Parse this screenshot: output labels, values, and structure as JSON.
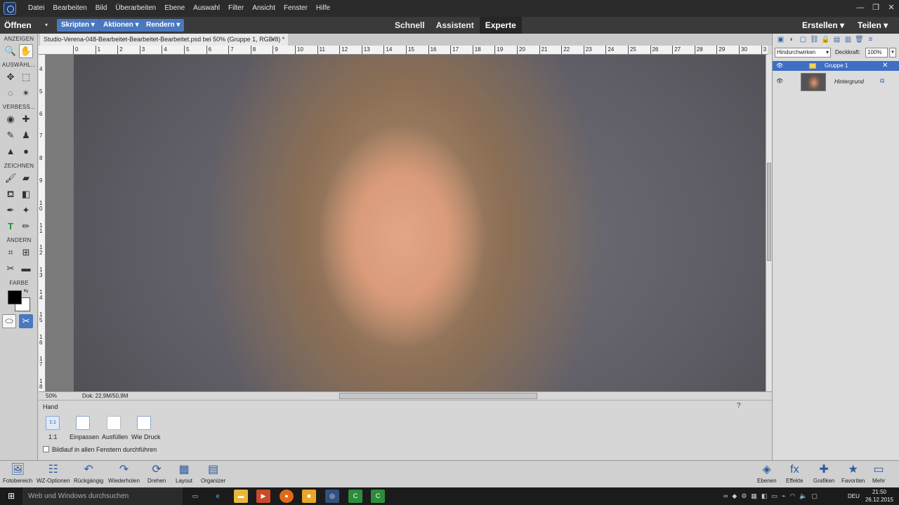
{
  "menu": [
    "Datei",
    "Bearbeiten",
    "Bild",
    "Überarbeiten",
    "Ebene",
    "Auswahl",
    "Filter",
    "Ansicht",
    "Fenster",
    "Hilfe"
  ],
  "window_controls": [
    "—",
    "❐",
    "✕"
  ],
  "modebar": {
    "open": "Öffnen",
    "open_arrow": "▾",
    "scripts": "Skripten",
    "actions": "Aktionen",
    "render": "Rendern",
    "tabs": [
      "Schnell",
      "Assistent",
      "Experte"
    ],
    "create": "Erstellen",
    "share": "Teilen"
  },
  "toolbox": {
    "sections": [
      "ANZEIGEN",
      "AUSWÄHL...",
      "VERBESS...",
      "ZEICHNEN",
      "ÄNDERN",
      "FARBE"
    ]
  },
  "document": {
    "tab_title": "Studio-Verena-048-Bearbeitet-Bearbeitet-Bearbeitet.psd bei 50% (Gruppe 1, RGB/8) *",
    "close": "×",
    "zoom": "50%",
    "doc_size": "Dok: 22,9M/50,9M",
    "ruler_h": [
      "0",
      "1",
      "2",
      "3",
      "4",
      "5",
      "6",
      "7",
      "8",
      "9",
      "10",
      "11",
      "12",
      "13",
      "14",
      "15",
      "16",
      "17",
      "18",
      "19",
      "20",
      "21",
      "22",
      "23",
      "24",
      "25",
      "26",
      "27",
      "28",
      "29",
      "30",
      "3"
    ],
    "ruler_v": [
      "4",
      "5",
      "6",
      "7",
      "8",
      "9",
      "1 0",
      "1 1",
      "1 2",
      "1 3",
      "1 4",
      "1 5",
      "1 6",
      "1 7",
      "1 8"
    ]
  },
  "tool_options": {
    "tool_name": "Hand",
    "buttons": [
      {
        "label": "1:1",
        "glyph": "1:1"
      },
      {
        "label": "Einpassen",
        "glyph": ""
      },
      {
        "label": "Ausfüllen",
        "glyph": ""
      },
      {
        "label": "Wie Druck",
        "glyph": ""
      }
    ],
    "checkbox_label": "Bildlauf in allen Fenstern durchführen",
    "help": "?"
  },
  "layers": {
    "blend_mode": "Hindurchwirken",
    "opacity_label": "Deckkraft:",
    "opacity": "100%",
    "group_name": "Gruppe 1",
    "layer_name": "Hintergrund"
  },
  "bottom_bar": [
    {
      "label": "Fotobereich",
      "icon": "photo-bin-icon"
    },
    {
      "label": "WZ-Optionen",
      "icon": "tool-options-icon"
    },
    {
      "label": "Rückgängig",
      "icon": "undo-icon"
    },
    {
      "label": "Wiederholen",
      "icon": "redo-icon"
    },
    {
      "label": "Drehen",
      "icon": "rotate-icon"
    },
    {
      "label": "Layout",
      "icon": "layout-icon"
    },
    {
      "label": "Organizer",
      "icon": "organizer-icon"
    },
    {
      "label": "Ebenen",
      "icon": "layers-icon"
    },
    {
      "label": "Effekte",
      "icon": "effects-icon"
    },
    {
      "label": "Grafiken",
      "icon": "graphics-icon"
    },
    {
      "label": "Favoriten",
      "icon": "favorites-icon"
    },
    {
      "label": "Mehr",
      "icon": "more-icon"
    }
  ],
  "taskbar": {
    "search_placeholder": "Web und Windows durchsuchen",
    "lang": "DEU",
    "time": "21:50",
    "date": "26.12.2015"
  },
  "colors": {
    "accent": "#4a78c0",
    "selected_layer": "#3f6fc4",
    "foreground": "#000000",
    "background": "#ffffff"
  }
}
